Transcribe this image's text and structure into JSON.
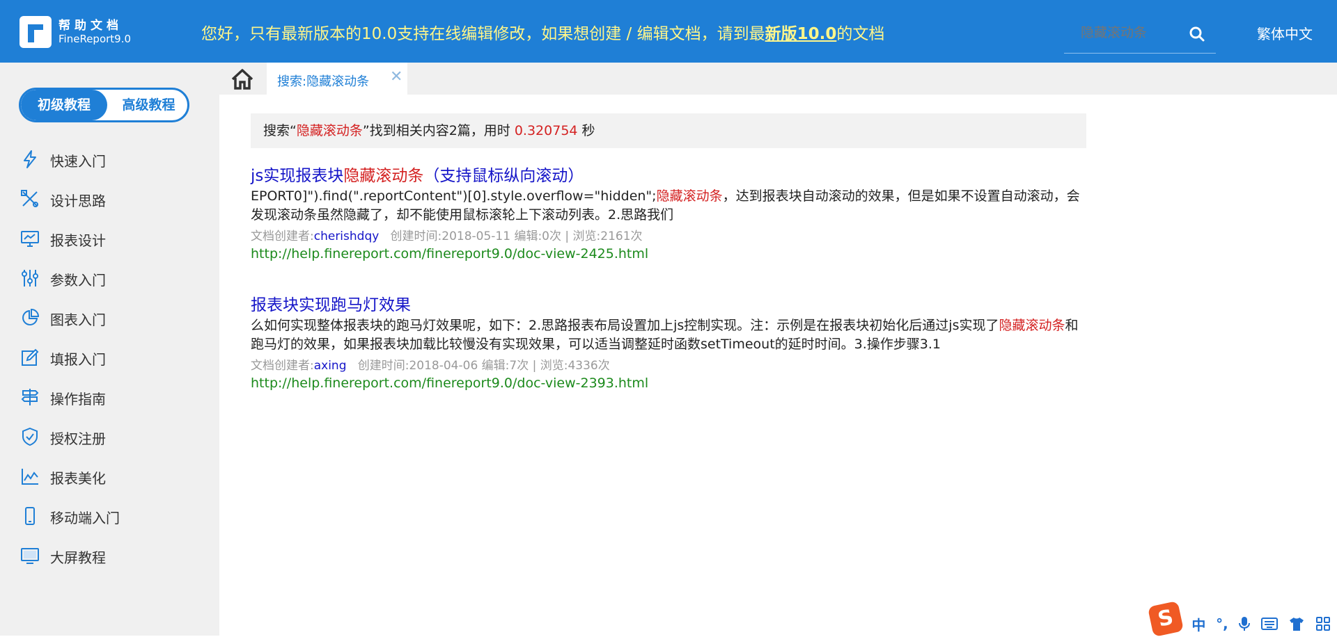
{
  "header": {
    "logo_line1": "帮助文档",
    "logo_line2": "FineReport9.0",
    "notice_prefix": "您好，只有最新版本的10.0支持在线编辑修改，如果想创建 / 编辑文档，请到最",
    "notice_link": "新版10.0",
    "notice_suffix": "的文档",
    "search_placeholder": "隐藏滚动条",
    "language": "繁体中文"
  },
  "sidebar": {
    "toggle": {
      "active": "初级教程",
      "other": "高级教程"
    },
    "items": [
      {
        "label": "快速入门",
        "icon": "lightning-icon"
      },
      {
        "label": "设计思路",
        "icon": "tools-icon"
      },
      {
        "label": "报表设计",
        "icon": "monitor-chart-icon"
      },
      {
        "label": "参数入门",
        "icon": "sliders-icon"
      },
      {
        "label": "图表入门",
        "icon": "pie-chart-icon"
      },
      {
        "label": "填报入门",
        "icon": "edit-icon"
      },
      {
        "label": "操作指南",
        "icon": "signpost-icon"
      },
      {
        "label": "授权注册",
        "icon": "shield-check-icon"
      },
      {
        "label": "报表美化",
        "icon": "line-chart-icon"
      },
      {
        "label": "移动端入门",
        "icon": "mobile-icon"
      },
      {
        "label": "大屏教程",
        "icon": "screen-icon"
      }
    ]
  },
  "tabs": {
    "home_icon": "home-icon",
    "active_tab": "搜索:隐藏滚动条",
    "close_glyph": "✕"
  },
  "summary": {
    "prefix": "搜索“",
    "keyword": "隐藏滚动条",
    "middle": "”找到相关内容2篇，用时 ",
    "time": "0.320754",
    "suffix": " 秒"
  },
  "results": [
    {
      "title_prefix": "js实现报表块",
      "title_highlight": "隐藏滚动条",
      "title_suffix": "（支持鼠标纵向滚动）",
      "snippet_part1": "EPORT0]\").find(\".reportContent\")[0].style.overflow=\"hidden\";",
      "snippet_highlight": "隐藏滚动条",
      "snippet_part2": "，达到报表块自动滚动的效果，但是如果不设置自动滚动，会发现滚动条虽然隐藏了，却不能使用鼠标滚轮上下滚动列表。2.思路我们",
      "author_label": "文档创建者:",
      "author": "cherishdqy",
      "meta": "创建时间:2018-05-11 编辑:0次 | 浏览:2161次",
      "url": "http://help.finereport.com/finereport9.0/doc-view-2425.html"
    },
    {
      "title": "报表块实现跑马灯效果",
      "snippet_part1": "么如何实现整体报表块的跑马灯效果呢，如下：2.思路报表布局设置加上js控制实现。注：示例是在报表块初始化后通过js实现了",
      "snippet_highlight": "隐藏滚动条",
      "snippet_part2": "和跑马灯的效果，如果报表块加载比较慢没有实现效果，可以适当调整延时函数setTimeout的延时时间。3.操作步骤3.1",
      "author_label": "文档创建者:",
      "author": "axing",
      "meta": "创建时间:2018-04-06 编辑:7次 | 浏览:4336次",
      "url": "http://help.finereport.com/finereport9.0/doc-view-2393.html"
    }
  ],
  "ime": {
    "logo": "S",
    "chinese": "中",
    "punct": "°,",
    "mic_icon": "microphone-icon",
    "keyboard_icon": "keyboard-icon",
    "skin_icon": "tshirt-icon",
    "apps_icon": "grid-icon"
  },
  "colors": {
    "brand": "#1f7fd6",
    "notice": "#fff68a",
    "highlight": "#d42222",
    "link": "#1515c8",
    "url": "#1c8a1c"
  }
}
